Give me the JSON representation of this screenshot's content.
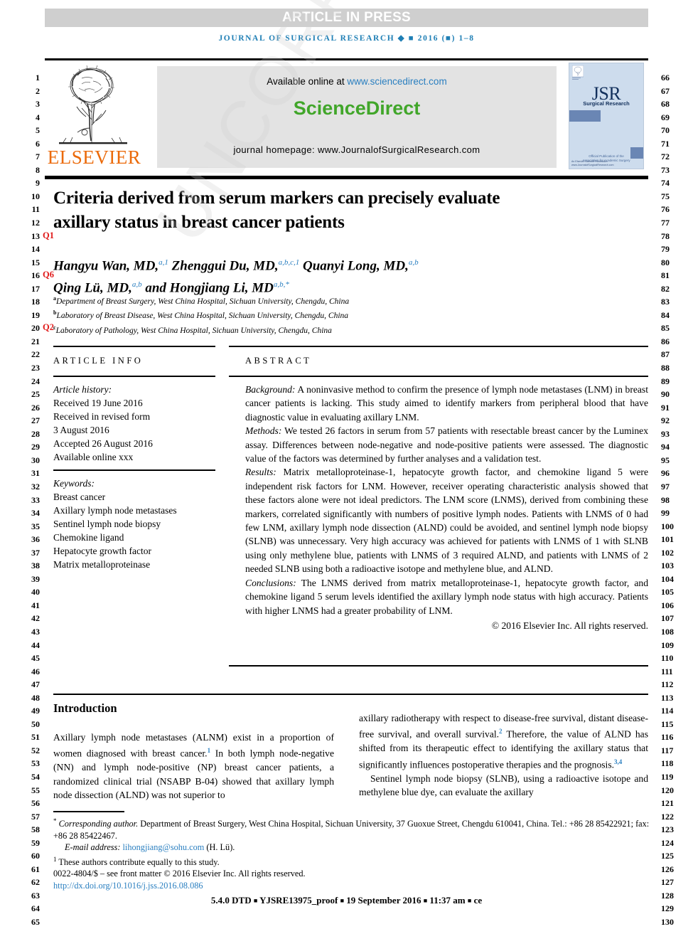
{
  "banner": {
    "text": "ARTICLE IN PRESS"
  },
  "journal_line": "JOURNAL OF SURGICAL RESEARCH ◆ ■ 2016 (■) 1–8",
  "masthead": {
    "elsevier_wordmark": "ELSEVIER",
    "available_prefix": "Available online at ",
    "sciencedirect_url": "www.sciencedirect.com",
    "sciencedirect_name": "ScienceDirect",
    "homepage": "journal homepage: www.JournalofSurgicalResearch.com",
    "cover": {
      "title": "JSR",
      "title_small": "Journal of",
      "subtitle": "Surgical Research",
      "assoc": "Official Publication of the\nAssociation for Academic Surgery",
      "footer": "An Elsevier Science Publication\nwww.JournalofSurgicalResearch.com"
    }
  },
  "article": {
    "title": "Criteria derived from serum markers can precisely evaluate axillary status in breast cancer patients",
    "authors_line1_a": "Hangyu Wan, MD,",
    "authors_line1_a_sup": "a,1",
    "authors_line1_b": " Zhenggui Du, MD,",
    "authors_line1_b_sup": "a,b,c,1",
    "authors_line1_c": " Quanyi Long, MD,",
    "authors_line1_c_sup": "a,b",
    "authors_line2_a": "Qing Lü, MD,",
    "authors_line2_a_sup": "a,b",
    "authors_line2_b": " and Hongjiang Li, MD",
    "authors_line2_b_sup": "a,b,*",
    "affiliations": [
      {
        "mark": "a",
        "text": "Department of Breast Surgery, West China Hospital, Sichuan University, Chengdu, China"
      },
      {
        "mark": "b",
        "text": "Laboratory of Breast Disease, West China Hospital, Sichuan University, Chengdu, China"
      },
      {
        "mark": "c",
        "text": "Laboratory of Pathology, West China Hospital, Sichuan University, Chengdu, China"
      }
    ]
  },
  "article_info": {
    "heading": "ARTICLE INFO",
    "history_label": "Article history:",
    "history": [
      "Received 19 June 2016",
      "Received in revised form",
      "3 August 2016",
      "Accepted 26 August 2016",
      "Available online xxx"
    ],
    "keywords_label": "Keywords:",
    "keywords": [
      "Breast cancer",
      "Axillary lymph node metastases",
      "Sentinel lymph node biopsy",
      "Chemokine ligand",
      "Hepatocyte growth factor",
      "Matrix metalloproteinase"
    ]
  },
  "abstract": {
    "heading": "ABSTRACT",
    "background_label": "Background:",
    "background": " A noninvasive method to confirm the presence of lymph node metastases (LNM) in breast cancer patients is lacking. This study aimed to identify markers from peripheral blood that have diagnostic value in evaluating axillary LNM.",
    "methods_label": "Methods:",
    "methods": " We tested 26 factors in serum from 57 patients with resectable breast cancer by the Luminex assay. Differences between node-negative and node-positive patients were assessed. The diagnostic value of the factors was determined by further analyses and a validation test.",
    "results_label": "Results:",
    "results": " Matrix metalloproteinase-1, hepatocyte growth factor, and chemokine ligand 5 were independent risk factors for LNM. However, receiver operating characteristic analysis showed that these factors alone were not ideal predictors. The LNM score (LNMS), derived from combining these markers, correlated significantly with numbers of positive lymph nodes. Patients with LNMS of 0 had few LNM, axillary lymph node dissection (ALND) could be avoided, and sentinel lymph node biopsy (SLNB) was unnecessary. Very high accuracy was achieved for patients with LNMS of 1 with SLNB using only methylene blue, patients with LNMS of 3 required ALND, and patients with LNMS of 2 needed SLNB using both a radioactive isotope and methylene blue, and ALND.",
    "conclusions_label": "Conclusions:",
    "conclusions": " The LNMS derived from matrix metalloproteinase-1, hepatocyte growth factor, and chemokine ligand 5 serum levels identified the axillary lymph node status with high accuracy. Patients with higher LNMS had a greater probability of LNM.",
    "rights": "© 2016 Elsevier Inc. All rights reserved."
  },
  "body": {
    "intro_heading": "Introduction",
    "left_p1_a": "Axillary lymph node metastases (ALNM) exist in a proportion of women diagnosed with breast cancer.",
    "left_p1_sup": "1",
    "left_p1_b": " In both lymph node-negative (NN) and lymph node-positive (NP) breast cancer patients, a randomized clinical trial (NSABP B-04) showed that axillary lymph node dissection (ALND) was not superior to",
    "right_p1_a": "axillary radiotherapy with respect to disease-free survival, distant disease-free survival, and overall survival.",
    "right_p1_sup": "2",
    "right_p1_b": " Therefore, the value of ALND has shifted from its therapeutic effect to identifying the axillary status that significantly influences postoperative therapies and the prognosis.",
    "right_p1_sup2": "3,4",
    "right_p2_a": "Sentinel lymph node biopsy (SLNB), using a radioactive isotope and methylene blue dye, can evaluate the axillary"
  },
  "footnote": {
    "corr_mark": "*",
    "corr_label": "Corresponding author.",
    "corr_text": " Department of Breast Surgery, West China Hospital, Sichuan University, 37 Guoxue Street, Chengdu 610041, China. Tel.: +86 28 85422921; fax: +86 28 85422467.",
    "email_label": "E-mail address: ",
    "email": "lihongjiang@sohu.com",
    "email_suffix": " (H. Lü).",
    "equal_mark": "1",
    "equal_text": " These authors contribute equally to this study.",
    "issn_line": "0022-4804/$ – see front matter © 2016 Elsevier Inc. All rights reserved.",
    "doi": "http://dx.doi.org/10.1016/j.jss.2016.08.086"
  },
  "page_footer": {
    "dtd": "5.4.0 DTD",
    "proof": "YJSRE13975_proof",
    "date": "19 September 2016",
    "time": "11:37 am",
    "ce": "ce",
    "sep": "■"
  },
  "line_numbers": {
    "left_start": 1,
    "left_end": 65,
    "right_start": 66,
    "right_end": 130,
    "queries": [
      {
        "line": 13,
        "label": "Q1"
      },
      {
        "line": 16,
        "label": "Q6"
      },
      {
        "line": 20,
        "label": "Q2"
      }
    ]
  },
  "watermark": {
    "text": "UNCORRECTED PROOF"
  },
  "colors": {
    "banner_bg": "#cfcfcf",
    "journal_blue": "#1f7fb5",
    "link_blue": "#2a7fc0",
    "sciencedirect_green": "#41a62a",
    "elsevier_orange": "#eb6a0a",
    "query_red": "#e01b1b",
    "cover_blue": "#cddced"
  }
}
